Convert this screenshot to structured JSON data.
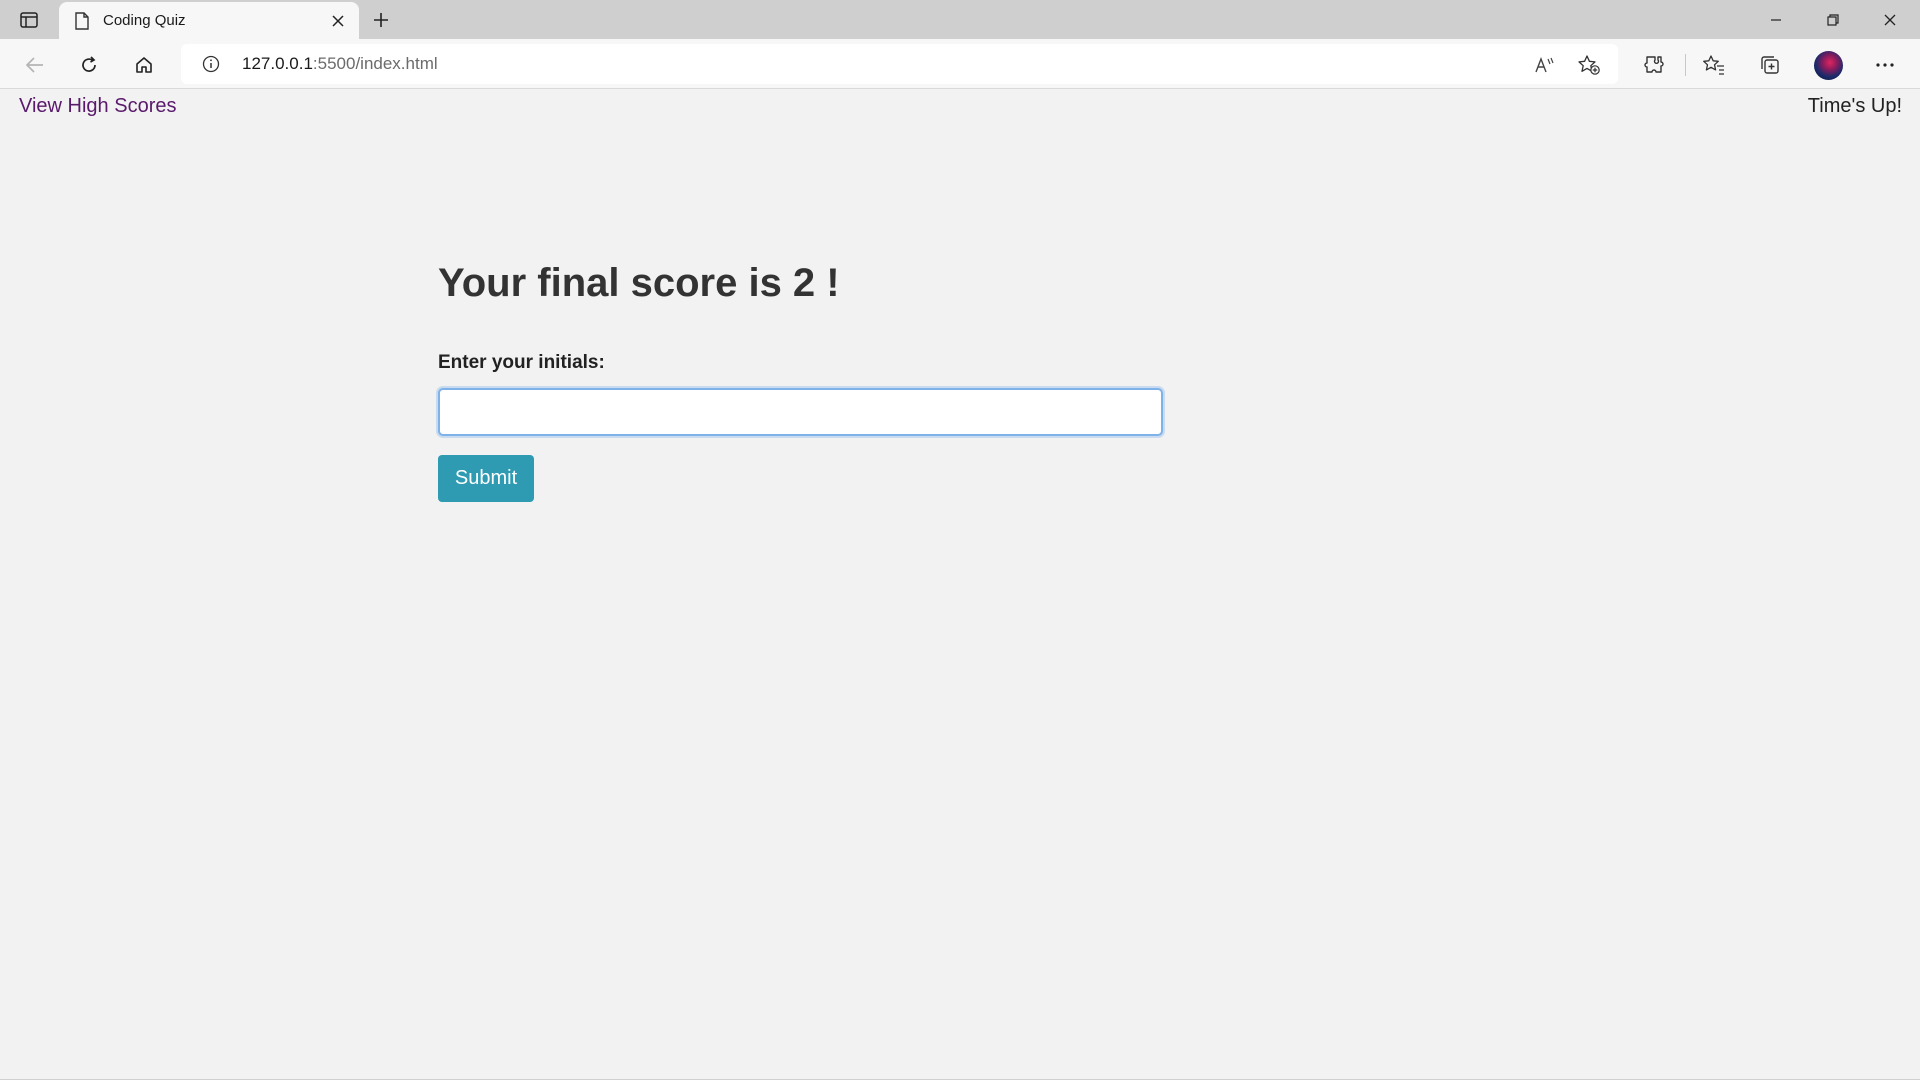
{
  "browser": {
    "tab": {
      "title": "Coding Quiz"
    },
    "address": {
      "url_host": "127.0.0.1",
      "url_rest": ":5500/index.html"
    }
  },
  "page": {
    "high_scores_link": "View High Scores",
    "timer_text": "Time's Up!",
    "score_heading": "Your final score is 2 !",
    "initials_label": "Enter your initials:",
    "initials_value": "",
    "submit_label": "Submit"
  },
  "colors": {
    "link": "#5a1a6b",
    "submit_button": "#2e9bb3",
    "input_focus": "#7fb2e8",
    "background": "#f2f2f2"
  }
}
